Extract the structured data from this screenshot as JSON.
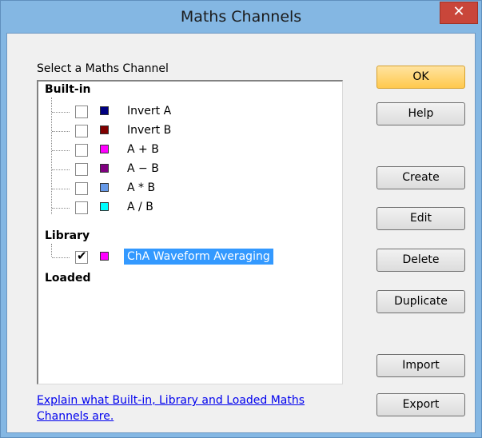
{
  "window": {
    "title": "Maths Channels",
    "close_glyph": "✕"
  },
  "list": {
    "group_label": "Select a Maths Channel",
    "categories": {
      "builtin": "Built-in",
      "library": "Library",
      "loaded": "Loaded"
    },
    "builtin_items": [
      {
        "label": "Invert A",
        "color": "#000080",
        "checked": false
      },
      {
        "label": "Invert B",
        "color": "#800000",
        "checked": false
      },
      {
        "label": "A + B",
        "color": "#ff00ff",
        "checked": false
      },
      {
        "label": "A − B",
        "color": "#800080",
        "checked": false
      },
      {
        "label": "A * B",
        "color": "#6699e8",
        "checked": false
      },
      {
        "label": "A / B",
        "color": "#00ffff",
        "checked": false
      }
    ],
    "library_items": [
      {
        "label": "ChA Waveform Averaging",
        "color": "#ff00ff",
        "checked": true,
        "selected": true
      }
    ]
  },
  "buttons": {
    "ok": "OK",
    "help": "Help",
    "create": "Create",
    "edit": "Edit",
    "delete": "Delete",
    "duplicate": "Duplicate",
    "import": "Import",
    "export": "Export"
  },
  "help_link": "Explain what Built-in, Library and Loaded Maths Channels are.",
  "icons": {
    "close": "close-icon",
    "check": "checkmark-icon"
  }
}
